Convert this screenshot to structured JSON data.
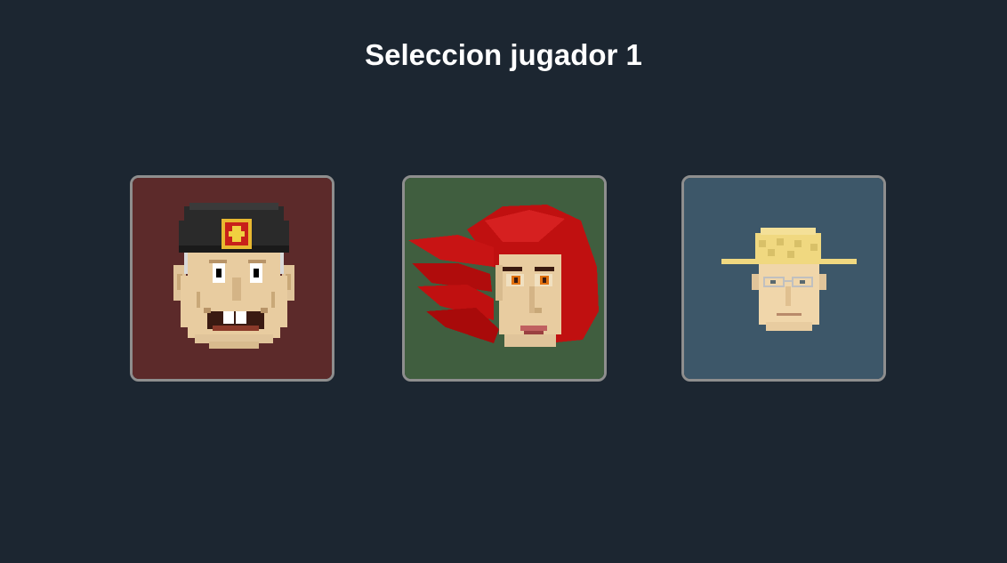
{
  "header": {
    "title": "Seleccion jugador 1"
  },
  "characters": [
    {
      "icon": "soviet-officer-portrait-icon",
      "background_color": "#5c2a2a"
    },
    {
      "icon": "red-haired-woman-portrait-icon",
      "background_color": "#405e3f"
    },
    {
      "icon": "straw-hat-farmer-portrait-icon",
      "background_color": "#3d5769"
    }
  ],
  "colors": {
    "page_background": "#1c2631",
    "card_border": "#8e8e8e",
    "title_text": "#ffffff"
  }
}
